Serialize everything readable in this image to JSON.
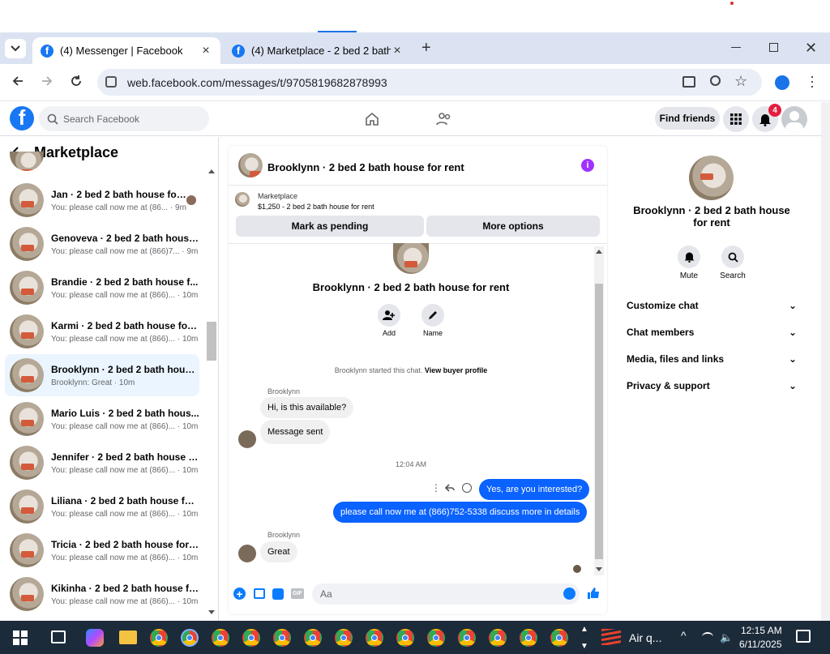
{
  "browser": {
    "tabs": [
      {
        "label": "(4) Messenger | Facebook",
        "active": true
      },
      {
        "label": "(4) Marketplace - 2 bed 2 bath h",
        "active": false
      }
    ],
    "url": "web.facebook.com/messages/t/9705819682878993"
  },
  "fb_header": {
    "search_placeholder": "Search Facebook",
    "find_friends": "Find friends",
    "notifications_count": "4"
  },
  "left_panel": {
    "title": "Marketplace",
    "conversations": [
      {
        "name": "Jan · 2 bed 2 bath house for ...",
        "sub": "You: please call now me at (86... · 9m"
      },
      {
        "name": "Genoveva · 2 bed 2 bath house...",
        "sub": "You: please call now me at (866)7... · 9m"
      },
      {
        "name": "Brandie · 2 bed 2 bath house f...",
        "sub": "You: please call now me at (866)... · 10m"
      },
      {
        "name": "Karmi · 2 bed 2 bath house for ...",
        "sub": "You: please call now me at (866)... · 10m"
      },
      {
        "name": "Brooklynn · 2 bed 2 bath house...",
        "sub": "Brooklynn: Great · 10m"
      },
      {
        "name": "Mario Luis · 2 bed 2 bath hous...",
        "sub": "You: please call now me at (866)... · 10m"
      },
      {
        "name": "Jennifer · 2 bed 2 bath house f...",
        "sub": "You: please call now me at (866)... · 10m"
      },
      {
        "name": "Liliana · 2 bed 2 bath house for...",
        "sub": "You: please call now me at (866)... · 10m"
      },
      {
        "name": "Tricia · 2 bed 2 bath house for r...",
        "sub": "You: please call now me at (866)... · 10m"
      },
      {
        "name": "Kikinha · 2 bed 2 bath house fo...",
        "sub": "You: please call now me at (866)... · 10m"
      }
    ]
  },
  "chat": {
    "header_title": "Brooklynn · 2 bed 2 bath house for rent",
    "listing_label": "Marketplace",
    "listing_detail": "$1,250 - 2 bed 2 bath house for rent",
    "mark_pending": "Mark as pending",
    "more_options": "More options",
    "profile_title": "Brooklynn · 2 bed 2 bath house for rent",
    "add_label": "Add",
    "name_label": "Name",
    "started_text": "Brooklynn started this chat.",
    "view_buyer": "View buyer profile",
    "sender": "Brooklynn",
    "msg1": "Hi, is this available?",
    "msg2": "Message sent",
    "time": "12:04 AM",
    "out1": "Yes, are you interested?",
    "out2": "please call now me at (866)752-5338 discuss more in details",
    "sender2": "Brooklynn",
    "msg3": "Great",
    "input_placeholder": "Aa"
  },
  "right_panel": {
    "title": "Brooklynn · 2 bed 2 bath house for rent",
    "mute": "Mute",
    "search": "Search",
    "sections": [
      "Customize chat",
      "Chat members",
      "Media, files and links",
      "Privacy & support"
    ]
  },
  "taskbar": {
    "weather": "Air q...",
    "time": "12:15 AM",
    "date": "6/11/2025"
  },
  "colors": {
    "brand": "#1877f2",
    "outgoing": "#0a62ff",
    "badge": "#e41e3f"
  }
}
